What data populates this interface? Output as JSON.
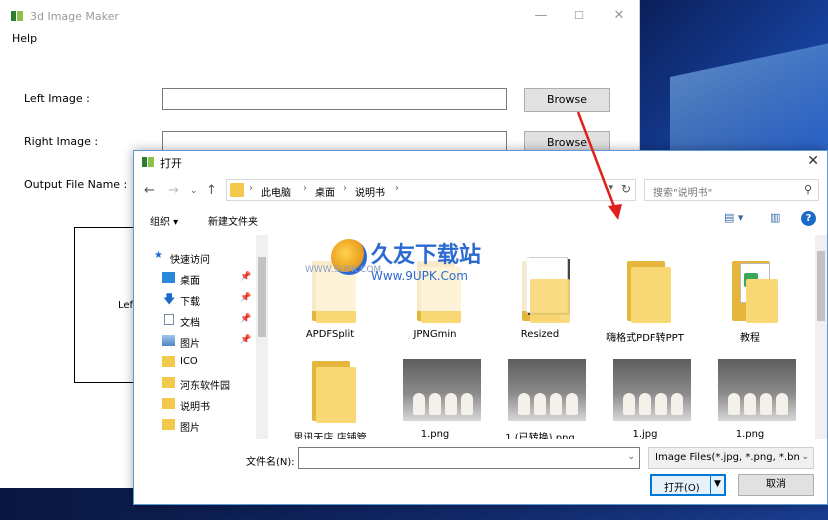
{
  "app": {
    "title": "3d Image Maker",
    "menu_help": "Help",
    "left_image_label": "Left Image :",
    "right_image_label": "Right Image :",
    "output_label": "Output File Name :",
    "browse_label": "Browse",
    "preview_text": "Lef"
  },
  "dialog": {
    "title": "打开",
    "address": [
      "此电脑",
      "桌面",
      "说明书"
    ],
    "search_placeholder": "搜索\"说明书\"",
    "toolbar": {
      "organize": "组织 ▾",
      "new_folder": "新建文件夹"
    },
    "nav_items": [
      {
        "label": "快速访问",
        "icon": "star-icon",
        "pinned": false
      },
      {
        "label": "桌面",
        "icon": "desktop-icon",
        "pinned": true
      },
      {
        "label": "下载",
        "icon": "download-icon",
        "pinned": true
      },
      {
        "label": "文档",
        "icon": "document-icon",
        "pinned": true
      },
      {
        "label": "图片",
        "icon": "pictures-icon",
        "pinned": true
      },
      {
        "label": "ICO",
        "icon": "folder-icon",
        "pinned": false
      },
      {
        "label": "河东软件园",
        "icon": "folder-icon",
        "pinned": false
      },
      {
        "label": "说明书",
        "icon": "folder-icon",
        "pinned": false
      },
      {
        "label": "图片",
        "icon": "folder-icon",
        "pinned": false
      }
    ],
    "files_row1": [
      {
        "name": "APDFSplit",
        "kind": "folder"
      },
      {
        "name": "JPNGmin",
        "kind": "folder"
      },
      {
        "name": "Resized",
        "kind": "folder"
      },
      {
        "name": "嗨格式PDF转PPT",
        "kind": "folder"
      },
      {
        "name": "教程",
        "kind": "folder"
      }
    ],
    "files_row2": [
      {
        "name": "思讯天店 店铺管",
        "kind": "folder"
      },
      {
        "name": "1.png",
        "kind": "photo"
      },
      {
        "name": "1 (已转换).png",
        "kind": "photo"
      },
      {
        "name": "1.jpg",
        "kind": "photo"
      },
      {
        "name": "1.png",
        "kind": "photo"
      }
    ],
    "filename_label": "文件名(N):",
    "filename_value": "",
    "filter": "Image Files(*.jpg, *.png, *.bn",
    "open_label": "打开(O)",
    "cancel_label": "取消"
  },
  "watermark": {
    "brand": "久友下载站",
    "url": "Www.9UPK.Com",
    "url_small": "WWW.9UPK.COM"
  },
  "colors": {
    "accent": "#0078d7",
    "folder": "#f8d775",
    "arrow": "#e0201b"
  }
}
